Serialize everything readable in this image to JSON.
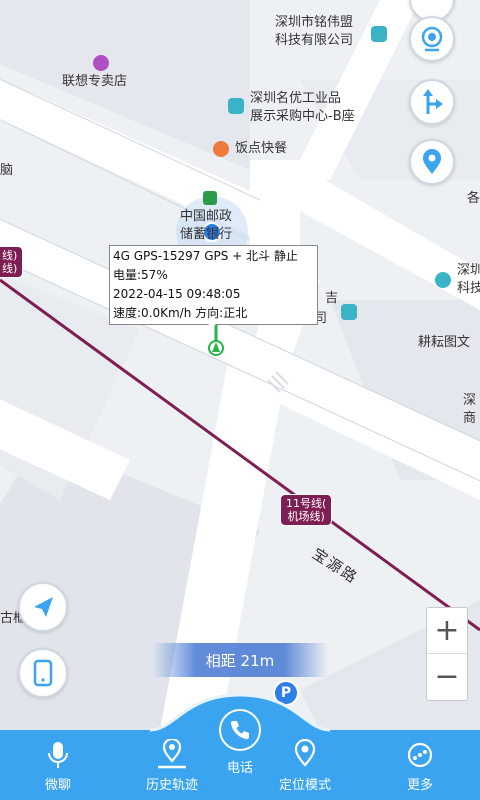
{
  "map": {
    "pois": {
      "mingwei": "深圳市铭伟盟\n科技有限公司",
      "lenovo": "联想专卖店",
      "mingyou": "深圳名优工业品\n展示采购中心-B座",
      "fandian": "饭点快餐",
      "nao": "脑",
      "bank": "中国邮政\n储蓄银行",
      "ji": "吉",
      "youxian": "有限公司",
      "right_sz": "深圳\n科技",
      "genyun": "耕耘图文",
      "shen_shang": "深\n商",
      "ge": "各",
      "gu": "古框"
    },
    "metro_left": "线)\n线)",
    "metro_label": "11号线(\n机场线)",
    "road_name": "宝源路",
    "info": {
      "line1": "4G GPS-15297 GPS + 北斗 静止",
      "line2": "电量:57%",
      "line3": "2022-04-15 09:48:05",
      "line4": "速度:0.0Km/h  方向:正北"
    },
    "distance": "相距 21m",
    "zoom_in": "+",
    "zoom_out": "−",
    "parking": "P"
  },
  "nav": {
    "items": [
      {
        "label": "微聊",
        "icon": "microphone-icon"
      },
      {
        "label": "历史轨迹",
        "icon": "history-track-icon"
      },
      {
        "label": "电话",
        "icon": "phone-icon"
      },
      {
        "label": "定位模式",
        "icon": "location-mode-icon"
      },
      {
        "label": "更多",
        "icon": "more-icon"
      }
    ]
  },
  "colors": {
    "accent": "#3aa4f0",
    "metro": "#7e1f53",
    "poi_orange": "#f07a3a",
    "poi_teal": "#3ab3c7"
  }
}
